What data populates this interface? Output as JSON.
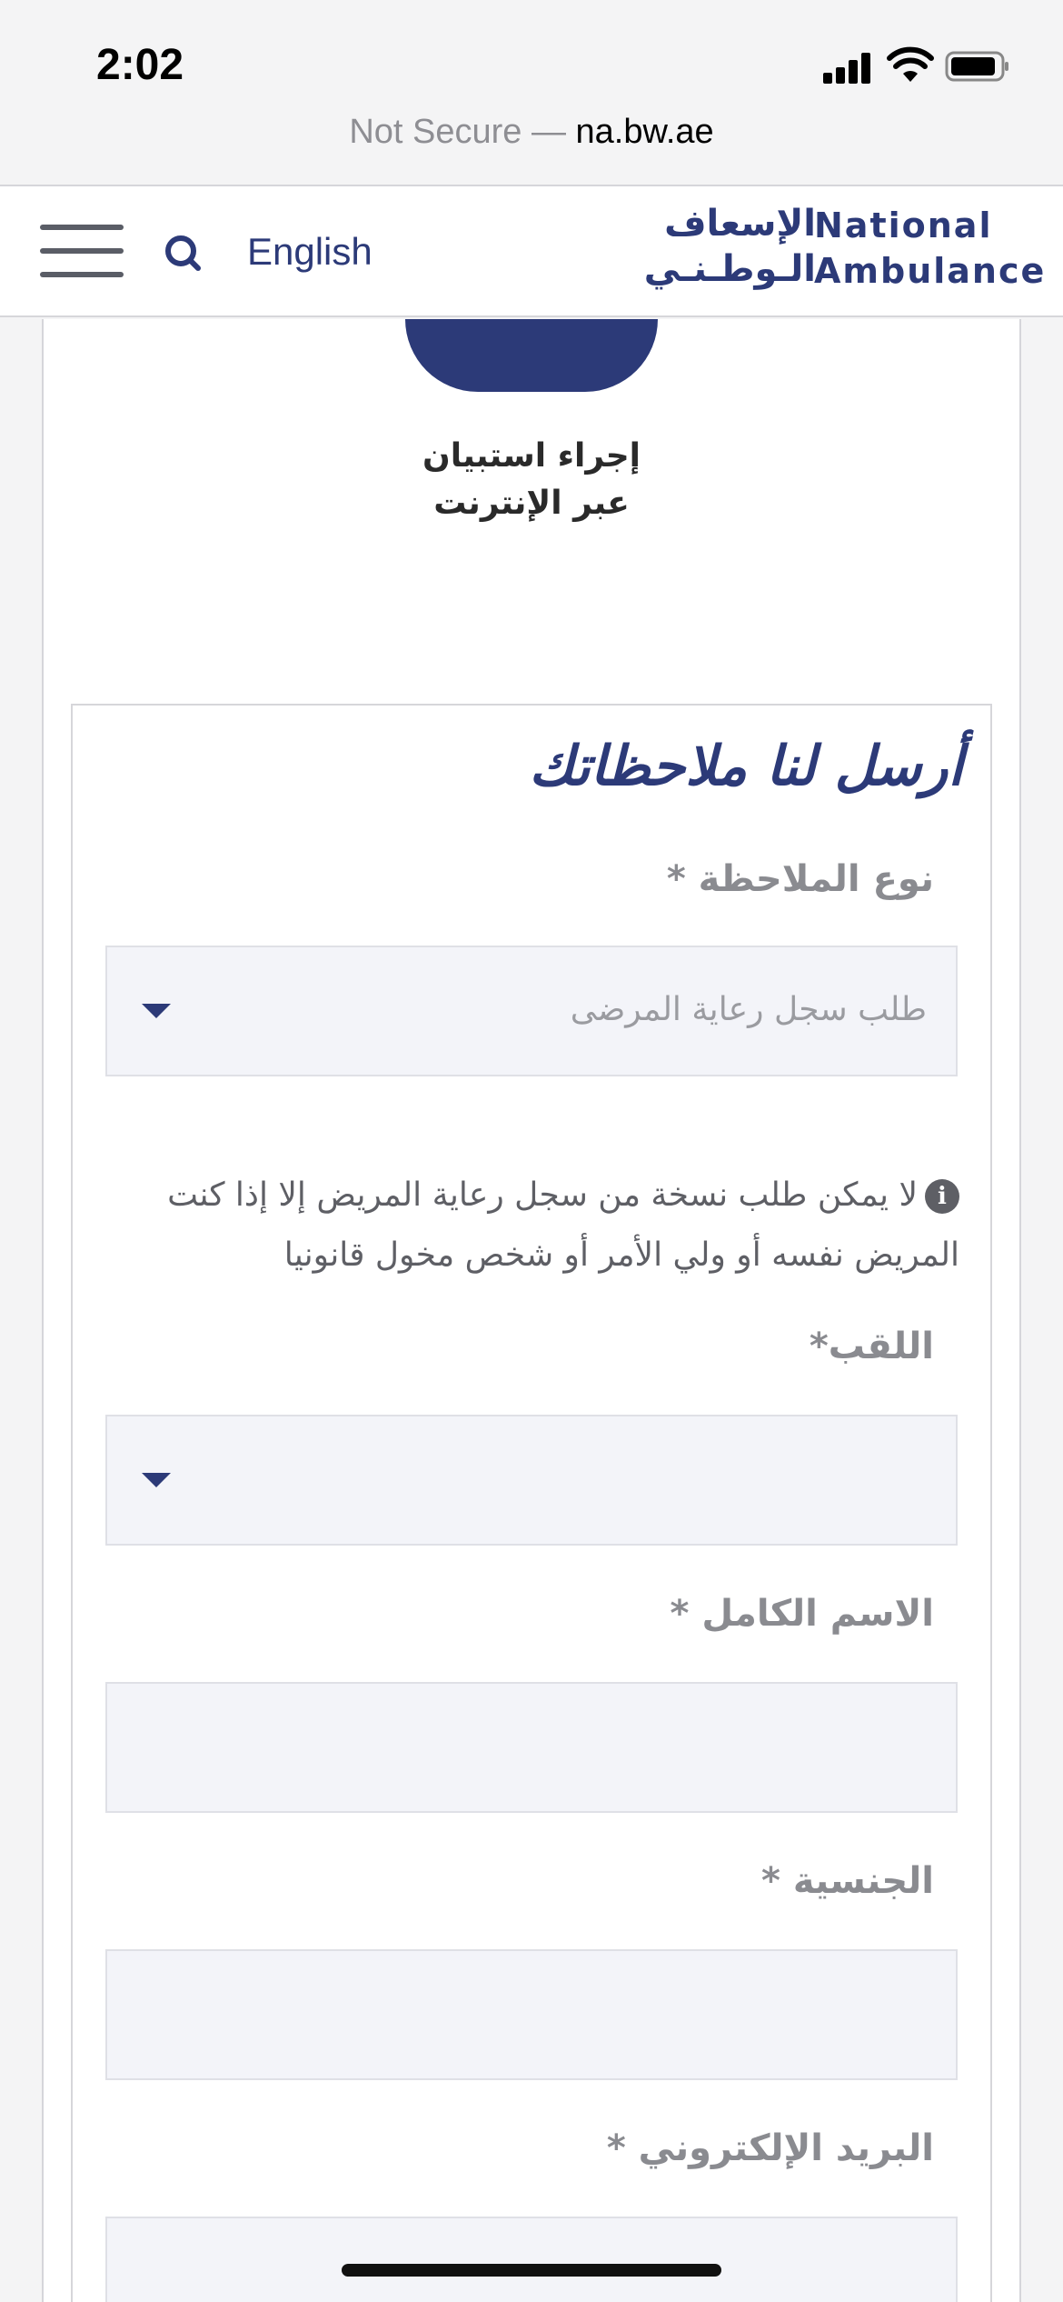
{
  "status_bar": {
    "time": "2:02",
    "url_prefix": "Not Secure — ",
    "url_domain": "na.bw.ae"
  },
  "header": {
    "language_link": "English",
    "logo_ar_line1": "الإسعاف",
    "logo_ar_line2": "الـوطـنـي",
    "logo_en_line1": "National",
    "logo_en_line2": "Ambulance",
    "brand_color": "#2c3a78"
  },
  "survey": {
    "label_line1": "إجراء استبيان",
    "label_line2": "عبر الإنترنت"
  },
  "form": {
    "title": "أرسل لنا ملاحظاتك",
    "note_type_label": "نوع الملاحظة *",
    "note_type_value": "طلب سجل رعاية المرضى",
    "notice_text": "لا يمكن طلب نسخة من سجل رعاية المريض إلا إذا كنت المريض نفسه أو ولي الأمر أو شخص مخول قانونيا",
    "title_label": "اللقب*",
    "title_value": "",
    "full_name_label": "الاسم الكامل *",
    "full_name_value": "",
    "nationality_label": "الجنسية *",
    "nationality_value": "",
    "email_label": "البريد الإلكتروني *",
    "email_value": ""
  }
}
